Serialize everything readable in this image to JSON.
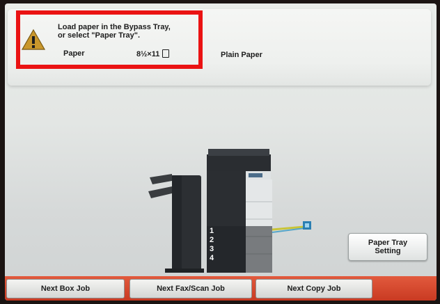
{
  "warning": {
    "message_line1": "Load paper in the Bypass Tray,",
    "message_line2": "or select \"Paper Tray\".",
    "paper_label": "Paper",
    "paper_size": "8½×11",
    "paper_type": "Plain Paper",
    "icon": "warning-triangle-icon",
    "highlight_color": "#ea1313"
  },
  "machine": {
    "tray_numbers": [
      "1",
      "2",
      "3",
      "4"
    ]
  },
  "buttons": {
    "paper_tray_setting_line1": "Paper Tray",
    "paper_tray_setting_line2": "Setting",
    "next_box_job": "Next Box Job",
    "next_fax_scan_job": "Next Fax/Scan Job",
    "next_copy_job": "Next Copy Job"
  },
  "colors": {
    "bottom_bar": "#d4462c"
  }
}
